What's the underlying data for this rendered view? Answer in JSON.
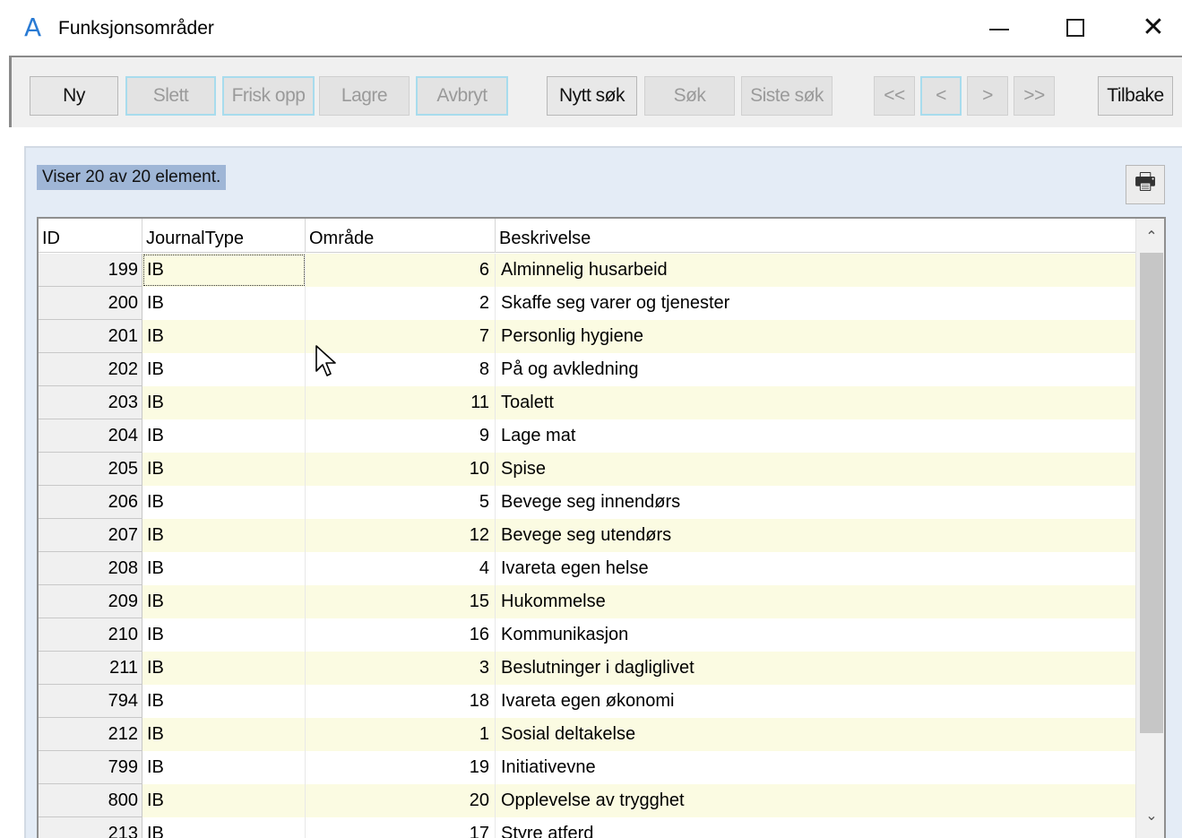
{
  "window": {
    "title": "Funksjonsområder",
    "app_icon_glyph": "A",
    "minimize_icon": "minimize-icon",
    "maximize_icon": "maximize-icon",
    "close_glyph": "✕"
  },
  "toolbar": {
    "buttons": [
      {
        "label": "Ny",
        "enabled": true
      },
      {
        "label": "Slett",
        "enabled": false
      },
      {
        "label": "Frisk opp",
        "enabled": false
      },
      {
        "label": "Lagre",
        "enabled": false
      },
      {
        "label": "Avbryt",
        "enabled": false
      },
      {
        "label": "Nytt søk",
        "enabled": true
      },
      {
        "label": "Søk",
        "enabled": false
      },
      {
        "label": "Siste søk",
        "enabled": false
      },
      {
        "label": "<<",
        "enabled": false
      },
      {
        "label": "<",
        "enabled": false
      },
      {
        "label": ">",
        "enabled": false
      },
      {
        "label": ">>",
        "enabled": false
      },
      {
        "label": "Tilbake",
        "enabled": true
      }
    ]
  },
  "status": {
    "text": "Viser 20 av 20 element."
  },
  "print": {
    "icon": "printer-icon",
    "glyph": "🖶"
  },
  "grid": {
    "columns": [
      "ID",
      "JournalType",
      "Område",
      "Beskrivelse"
    ],
    "rows": [
      {
        "id": "199",
        "journaltype": "IB",
        "omrade": "6",
        "beskrivelse": "Alminnelig husarbeid"
      },
      {
        "id": "200",
        "journaltype": "IB",
        "omrade": "2",
        "beskrivelse": "Skaffe seg varer og tjenester"
      },
      {
        "id": "201",
        "journaltype": "IB",
        "omrade": "7",
        "beskrivelse": "Personlig hygiene"
      },
      {
        "id": "202",
        "journaltype": "IB",
        "omrade": "8",
        "beskrivelse": "På og avkledning"
      },
      {
        "id": "203",
        "journaltype": "IB",
        "omrade": "11",
        "beskrivelse": "Toalett"
      },
      {
        "id": "204",
        "journaltype": "IB",
        "omrade": "9",
        "beskrivelse": "Lage mat"
      },
      {
        "id": "205",
        "journaltype": "IB",
        "omrade": "10",
        "beskrivelse": "Spise"
      },
      {
        "id": "206",
        "journaltype": "IB",
        "omrade": "5",
        "beskrivelse": "Bevege seg innendørs"
      },
      {
        "id": "207",
        "journaltype": "IB",
        "omrade": "12",
        "beskrivelse": "Bevege seg utendørs"
      },
      {
        "id": "208",
        "journaltype": "IB",
        "omrade": "4",
        "beskrivelse": "Ivareta egen helse"
      },
      {
        "id": "209",
        "journaltype": "IB",
        "omrade": "15",
        "beskrivelse": "Hukommelse"
      },
      {
        "id": "210",
        "journaltype": "IB",
        "omrade": "16",
        "beskrivelse": "Kommunikasjon"
      },
      {
        "id": "211",
        "journaltype": "IB",
        "omrade": "3",
        "beskrivelse": "Beslutninger i dagliglivet"
      },
      {
        "id": "794",
        "journaltype": "IB",
        "omrade": "18",
        "beskrivelse": "Ivareta egen økonomi"
      },
      {
        "id": "212",
        "journaltype": "IB",
        "omrade": "1",
        "beskrivelse": "Sosial deltakelse"
      },
      {
        "id": "799",
        "journaltype": "IB",
        "omrade": "19",
        "beskrivelse": "Initiativevne"
      },
      {
        "id": "800",
        "journaltype": "IB",
        "omrade": "20",
        "beskrivelse": "Opplevelse av trygghet"
      },
      {
        "id": "213",
        "journaltype": "IB",
        "omrade": "17",
        "beskrivelse": "Styre atferd"
      }
    ]
  },
  "scrollbar": {
    "up_glyph": "⌃",
    "down_glyph": "⌄"
  },
  "colors": {
    "accent": "#2a7bd4",
    "row_alt": "#fbfbe2",
    "status_bg": "#9fb6d6",
    "panel_bg": "#e4ecf6",
    "focus_border": "#a8dced"
  }
}
